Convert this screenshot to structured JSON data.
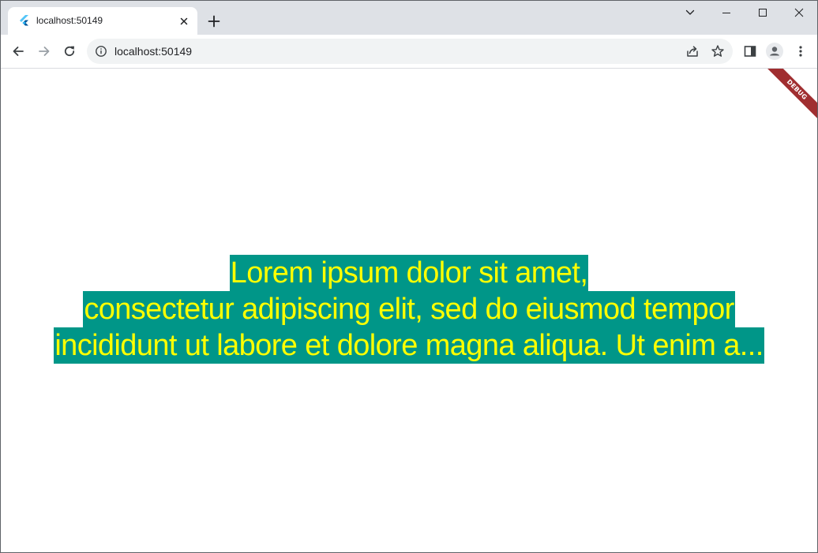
{
  "browser": {
    "tab": {
      "title": "localhost:50149",
      "favicon": "flutter-logo-icon"
    },
    "new_tab_label": "+",
    "address_bar": {
      "url": "localhost:50149"
    },
    "toolbar_icons": [
      "back-arrow-icon",
      "forward-arrow-icon",
      "reload-icon",
      "site-info-icon",
      "share-icon",
      "bookmark-star-icon",
      "side-panel-icon",
      "profile-icon",
      "menu-kebab-icon"
    ],
    "window_controls": [
      "tab-search-chevron-icon",
      "minimize-icon",
      "maximize-icon",
      "close-icon"
    ]
  },
  "page": {
    "debug_banner": "DEBUG",
    "lines": [
      "Lorem ipsum dolor sit amet,",
      "consectetur adipiscing elit, sed do eiusmod tempor",
      "incididunt ut labore et dolore magna aliqua. Ut enim a..."
    ]
  },
  "colors": {
    "text_background": "#009688",
    "text_color": "#ffff00",
    "debug_banner": "#a02e30",
    "tabstrip": "#dee1e6",
    "omnibox": "#f1f3f4"
  }
}
